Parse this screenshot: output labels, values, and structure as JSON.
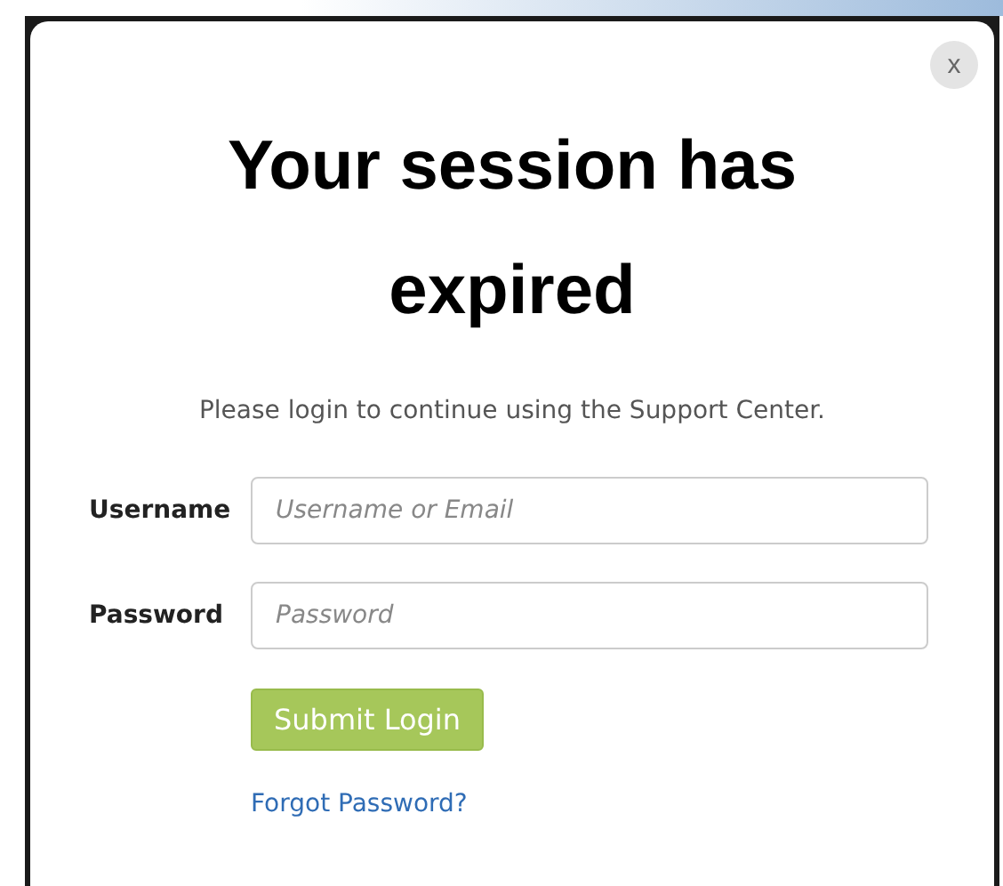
{
  "dialog": {
    "close": "x",
    "title": "Your session has expired",
    "message": "Please login to continue using the Support Center.",
    "fields": [
      {
        "label": "Username",
        "placeholder": "Username or Email"
      },
      {
        "label": "Password",
        "placeholder": "Password"
      }
    ],
    "submit": "Submit Login",
    "link": "Forgot Password?"
  }
}
